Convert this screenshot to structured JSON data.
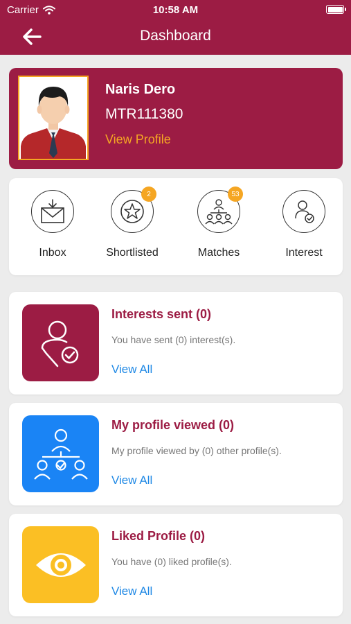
{
  "status": {
    "carrier": "Carrier",
    "time": "10:58 AM"
  },
  "header": {
    "title": "Dashboard"
  },
  "profile": {
    "name": "Naris Dero",
    "id": "MTR111380",
    "view_label": "View Profile"
  },
  "quick": {
    "inbox": {
      "label": "Inbox"
    },
    "shortlisted": {
      "label": "Shortlisted",
      "badge": "2"
    },
    "matches": {
      "label": "Matches",
      "badge": "53"
    },
    "interest": {
      "label": "Interest"
    }
  },
  "cards": {
    "interests_sent": {
      "title": "Interests sent (0)",
      "desc": "You have sent (0) interest(s).",
      "link": "View All"
    },
    "profile_viewed": {
      "title": "My profile viewed (0)",
      "desc": "My profile viewed by (0) other profile(s).",
      "link": "View All"
    },
    "liked_profile": {
      "title": "Liked Profile (0)",
      "desc": "You have (0) liked profile(s).",
      "link": "View All"
    }
  },
  "colors": {
    "brand": "#9c1c44",
    "accent": "#f5a623",
    "link": "#1e88e5",
    "blue_tile": "#1a84f5",
    "yellow_tile": "#fbbf24"
  }
}
